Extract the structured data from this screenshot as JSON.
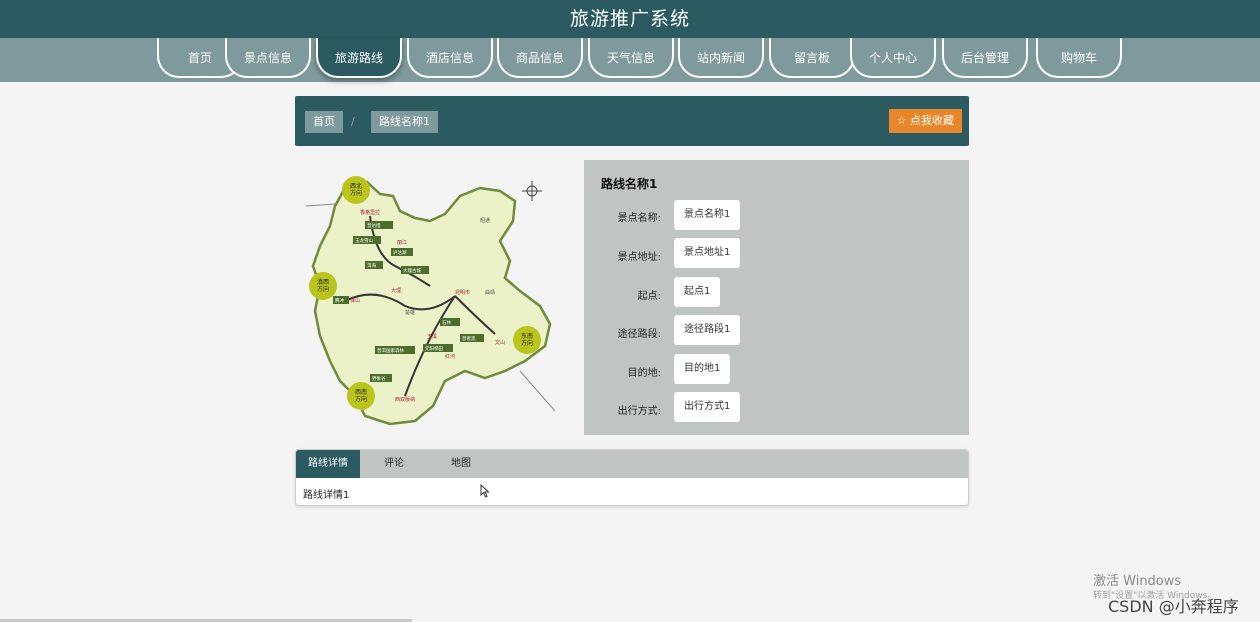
{
  "app": {
    "title": "旅游推广系统"
  },
  "nav": [
    {
      "label": "首页"
    },
    {
      "label": "景点信息"
    },
    {
      "label": "旅游路线",
      "active": true
    },
    {
      "label": "酒店信息"
    },
    {
      "label": "商品信息"
    },
    {
      "label": "天气信息"
    },
    {
      "label": "站内新闻"
    },
    {
      "label": "留言板"
    },
    {
      "label": "个人中心"
    },
    {
      "label": "后台管理"
    },
    {
      "label": "购物车"
    }
  ],
  "breadcrumb": {
    "home": "首页",
    "separator": "/",
    "current": "路线名称1"
  },
  "favorite_button": {
    "icon": "star-icon",
    "label": "☆ 点我收藏"
  },
  "map": {
    "regions": [
      "西北\n方向",
      "滇西\n方向",
      "东南\n方向",
      "西南\n方向"
    ],
    "city_labels": [
      "香格里拉",
      "丽江",
      "大理",
      "保山",
      "昆明市",
      "玉溪",
      "红河",
      "文山",
      "西双版纳",
      "楚雄",
      "曲靖",
      "昭通"
    ],
    "route_labels": [
      "普达措",
      "玉龙雪山",
      "泸沽湖",
      "洱海",
      "大理古城",
      "腾冲",
      "石林",
      "抚仙湖",
      "元阳梯田",
      "普者黑",
      "坝美",
      "野象谷",
      "普洱国家森林"
    ]
  },
  "route": {
    "title": "路线名称1",
    "fields": [
      {
        "label": "景点名称:",
        "value": "景点名称1"
      },
      {
        "label": "景点地址:",
        "value": "景点地址1"
      },
      {
        "label": "起点:",
        "value": "起点1"
      },
      {
        "label": "途径路段:",
        "value": "途径路段1"
      },
      {
        "label": "目的地:",
        "value": "目的地1"
      },
      {
        "label": "出行方式:",
        "value": "出行方式1"
      }
    ]
  },
  "tabs": [
    {
      "label": "路线详情",
      "active": true
    },
    {
      "label": "评论"
    },
    {
      "label": "地图"
    }
  ],
  "tab_content": "路线详情1",
  "watermark": {
    "line1": "激活 Windows",
    "line2": "转到\"设置\"以激活 Windows。"
  },
  "credit": "CSDN @小奔程序",
  "colors": {
    "primary": "#2b5a61",
    "nav": "#7f9a9d",
    "panel": "#c0c5c4",
    "accent": "#e8862a"
  }
}
